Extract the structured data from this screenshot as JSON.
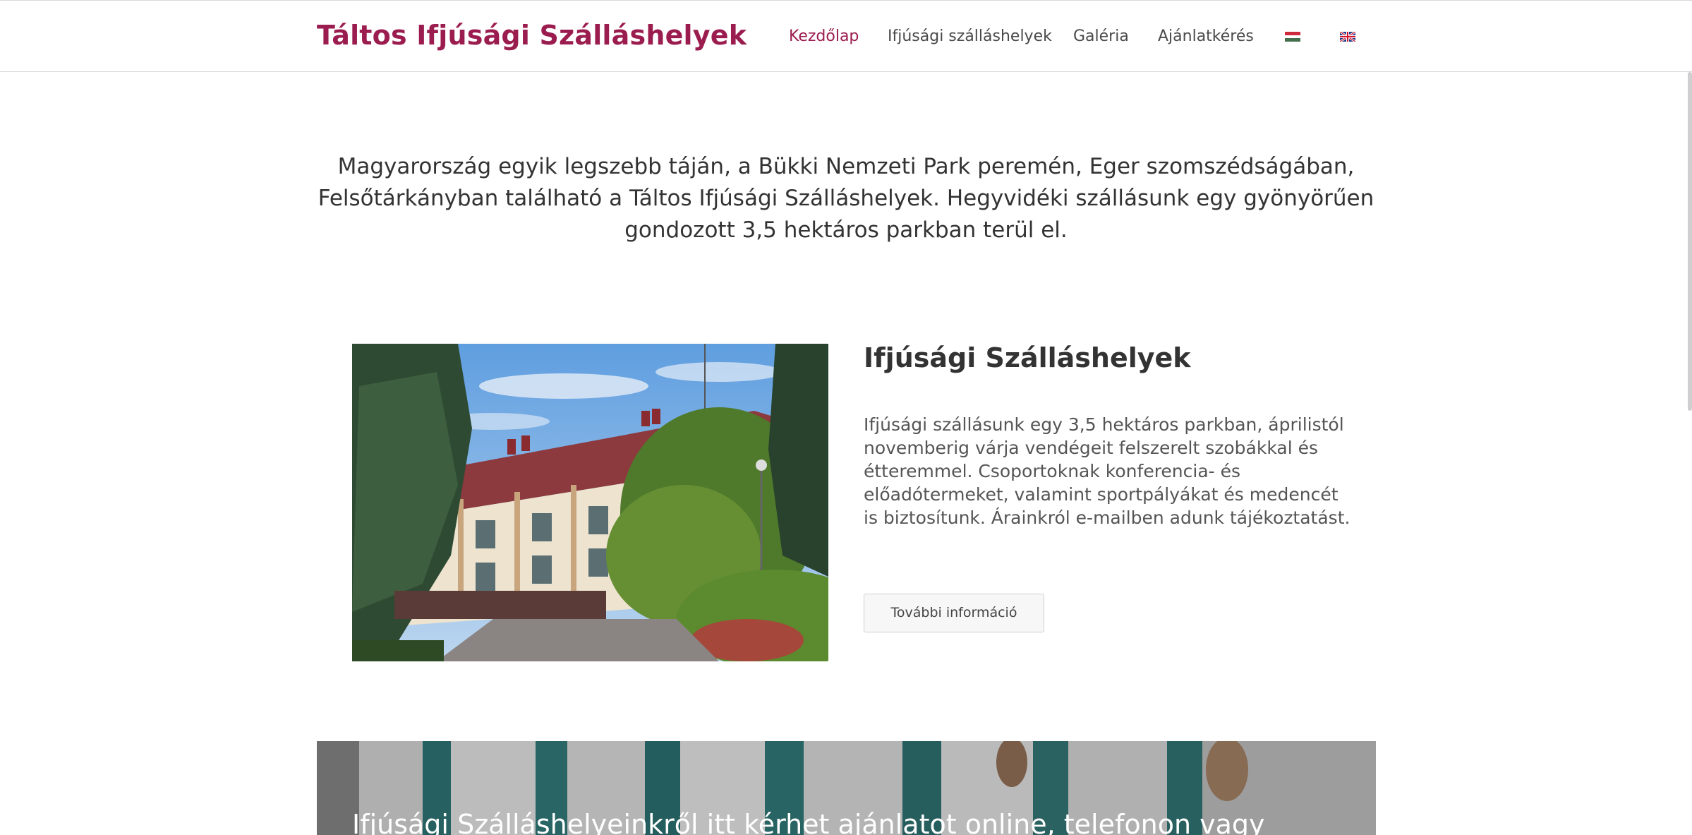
{
  "header": {
    "brand": "Táltos Ifjúsági Szálláshelyek",
    "nav": {
      "home": "Kezdőlap",
      "accommodations": "Ifjúsági szálláshelyek",
      "gallery": "Galéria",
      "quote": "Ajánlatkérés"
    },
    "languages": [
      "hu-flag-icon",
      "uk-flag-icon"
    ]
  },
  "intro": {
    "text": "Magyarország egyik legszebb táján, a Bükki Nemzeti Park peremén, Eger szomszédságában, Felsőtárkányban található a Táltos Ifjúsági Szálláshelyek. Hegyvidéki szállásunk egy gyönyörűen gondozott 3,5 hektáros parkban terül el."
  },
  "feature": {
    "title": "Ifjúsági Szálláshelyek",
    "text": "Ifjúsági szállásunk egy 3,5 hektáros parkban, áprilistól novemberig várja vendégeit felszerelt szobákkal és étteremmel. Csoportoknak konferencia- és előadótermeket, valamint sportpályákat és medencét is biztosítunk. Árainkról e-mailben adunk tájékoztatást.",
    "button": "További információ"
  },
  "banner": {
    "text": "Ifjúsági Szálláshelyeinkről itt kérhet ajánlatot online, telefonon vagy"
  },
  "colors": {
    "brand": "#9b1d4f",
    "text": "#333333",
    "border": "#d9d9d9"
  }
}
